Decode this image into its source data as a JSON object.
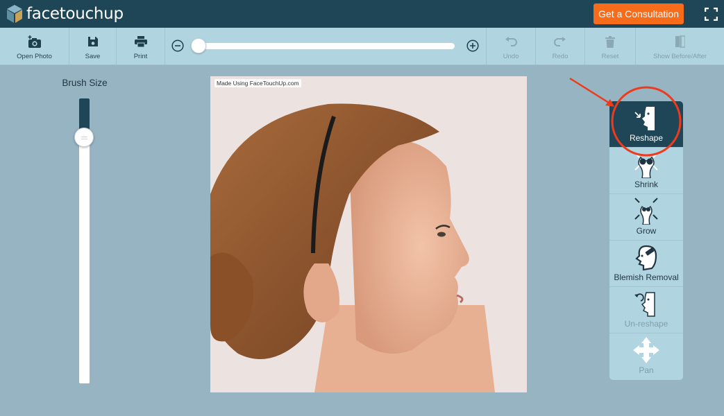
{
  "app": {
    "logo_text": "facetouchup"
  },
  "header": {
    "consult_label": "Get a Consultation"
  },
  "toolbar": {
    "open_photo": "Open Photo",
    "save": "Save",
    "print": "Print",
    "undo": "Undo",
    "redo": "Redo",
    "reset": "Reset",
    "show_before_after": "Show Before/After"
  },
  "brush": {
    "title": "Brush Size"
  },
  "photo": {
    "watermark": "Made Using FaceTouchUp.com"
  },
  "tools": {
    "reshape": "Reshape",
    "shrink": "Shrink",
    "grow": "Grow",
    "blemish": "Blemish Removal",
    "unreshape": "Un-reshape",
    "pan": "Pan"
  },
  "colors": {
    "topbar": "#1f4656",
    "toolbar": "#b1d4e1",
    "background": "#97b4c3",
    "accent": "#f76c1a",
    "annotation": "#ee3b1e"
  }
}
